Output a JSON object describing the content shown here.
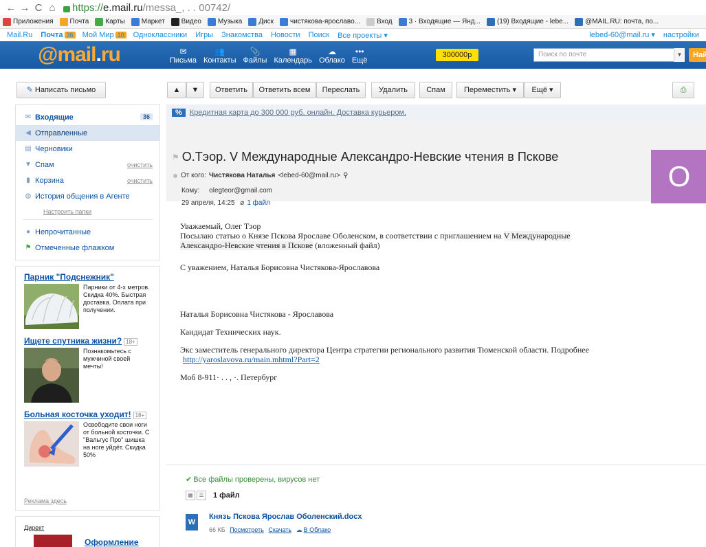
{
  "browser": {
    "url_scheme": "https://",
    "url_host": "e.mail.ru",
    "url_rest": "/messa_,         .    .  00742/"
  },
  "bookmarks": [
    {
      "label": "Приложения",
      "color": "#d44"
    },
    {
      "label": "Почта",
      "color": "#f5a623"
    },
    {
      "label": "Карты",
      "color": "#4a4"
    },
    {
      "label": "Маркет",
      "color": "#3a7bd5"
    },
    {
      "label": "Видео",
      "color": "#222"
    },
    {
      "label": "Музыка",
      "color": "#3a7bd5"
    },
    {
      "label": "Диск",
      "color": "#3a7bd5"
    },
    {
      "label": "чистякова-ярославо...",
      "color": "#3a7bd5"
    },
    {
      "label": "Вход",
      "color": "#ccc"
    },
    {
      "label": "3 · Входящие — Янд...",
      "color": "#3a7bd5"
    },
    {
      "label": "(19) Входящие - lebe...",
      "color": "#2b6fb8"
    },
    {
      "label": "@MAIL.RU: почта, по...",
      "color": "#2b6fb8"
    }
  ],
  "portal": {
    "links": [
      "Mail.Ru",
      "Почта",
      "Мой Мир",
      "Одноклассники",
      "Игры",
      "Знакомства",
      "Новости",
      "Поиск",
      "Все проекты ▾"
    ],
    "mail_badge": "36",
    "world_badge": "10",
    "user": "lebed-60@mail.ru ▾",
    "settings": "настройки"
  },
  "header": {
    "logo_at": "@",
    "logo_text": "mail",
    "logo_dot": ".",
    "logo_ru": "ru",
    "nav": [
      {
        "label": "Письма",
        "icon": "✉"
      },
      {
        "label": "Контакты",
        "icon": "👥"
      },
      {
        "label": "Файлы",
        "icon": "📎"
      },
      {
        "label": "Календарь",
        "icon": "▦"
      },
      {
        "label": "Облако",
        "icon": "☁"
      },
      {
        "label": "Ещё",
        "icon": "•••"
      }
    ],
    "balance": "300000р",
    "search_placeholder": "Поиск по почте",
    "search_button": "Най"
  },
  "toolbar": {
    "compose": "Написать письмо",
    "up": "▲",
    "down": "▼",
    "reply": "Ответить",
    "reply_all": "Ответить всем",
    "forward": "Переслать",
    "delete": "Удалить",
    "spam": "Спам",
    "move": "Переместить ▾",
    "more": "Ещё ▾"
  },
  "folders": [
    {
      "label": "Входящие",
      "icon": "✉",
      "count": "36",
      "bold": true
    },
    {
      "label": "Отправленные",
      "icon": "◀",
      "active": true
    },
    {
      "label": "Черновики",
      "icon": "▤"
    },
    {
      "label": "Спам",
      "icon": "▼",
      "clear": "очистить"
    },
    {
      "label": "Корзина",
      "icon": "▮",
      "clear": "очистить"
    },
    {
      "label": "История общения в Агенте",
      "icon": "◍"
    }
  ],
  "setup_folders": "Настроить папки",
  "filters": [
    {
      "label": "Непрочитанные",
      "icon": "●"
    },
    {
      "label": "Отмеченные флажком",
      "icon": "⚑"
    }
  ],
  "ads": [
    {
      "title": "Парник \"Подснежник\"",
      "age": "",
      "text": "Парники от 4-х метров. Скидка 40%. Быстрая доставка. Оплата при получении."
    },
    {
      "title": "Ищете спутника жизни?",
      "age": "18+",
      "text": "Познакомьтесь с мужчиной своей мечты!"
    },
    {
      "title": "Больная косточка уходит!",
      "age": "18+",
      "text": "Освободите свои ноги от больной косточки. С \"Вальгус Про\" шишка на ноге уйдёт. Скидка 50%"
    }
  ],
  "ads_footer": "Реклама здесь",
  "direct": {
    "label": "Директ",
    "title": "Оформление"
  },
  "message": {
    "promo_badge": "%",
    "promo_text": "Кредитная карта до 300 000 руб. онлайн. Доставка курьером.",
    "subject": "О.Тэор. V Международные Александро-Невские чтения в Пскове",
    "from_label": "От кого:",
    "from_name": "Чистякова Наталья",
    "from_email": "<lebed-60@mail.ru>",
    "to_label": "Кому:",
    "to_value": "olegteor@gmail.com",
    "date": "29 апреля, 14:25",
    "files_link": "1 файл",
    "avatar_letter": "О",
    "body": {
      "greeting": "Уважаемый,   Олег Тэор",
      "line1a": "Посылаю   статью о Князе Пскова Ярославе Оболенском, в соответствии с приглашением на ",
      "line1b": "V Международные",
      "line2a": "Александро-Невские чтения в Пскове",
      "line2b": "  (вложенный файл)",
      "regards": "С уважением, Наталья Борисовна   Чистякова-Ярославова",
      "sig_name": "Наталья  Борисовна  Чистякова - Ярославова",
      "sig_degree": "Кандидат  Технических наук.",
      "sig_pos": "Экс  заместитель генерального директора  Центра  стратегии регионального  развития  Тюменской  области. Подробнее",
      "sig_link": "http://yaroslavova.ru/main.mhtml?Part=2",
      "sig_phone": "Моб  8-911·          .  .  ,  ·.  Петербург"
    },
    "virus": "Все файлы проверены, вирусов нет",
    "files_count": "1 файл",
    "file": {
      "name": "Князь Пскова Ярослав Оболенский.docx",
      "size": "66 КБ",
      "view": "Посмотреть",
      "download": "Скачать",
      "cloud": "В Облако"
    }
  }
}
